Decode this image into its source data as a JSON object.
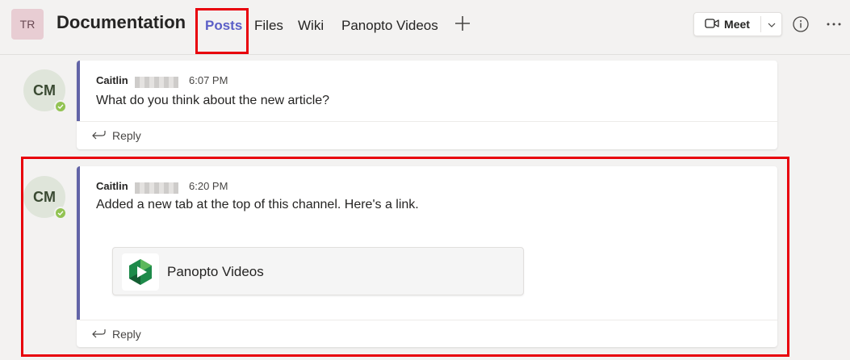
{
  "header": {
    "team_initials": "TR",
    "channel_title": "Documentation",
    "tabs": [
      {
        "label": "Posts",
        "active": true
      },
      {
        "label": "Files",
        "active": false
      },
      {
        "label": "Wiki",
        "active": false
      },
      {
        "label": "Panopto Videos",
        "active": false
      }
    ],
    "meet_label": "Meet"
  },
  "posts": [
    {
      "avatar_initials": "CM",
      "author": "Caitlin",
      "time": "6:07 PM",
      "message": "What do you think about the new article?",
      "reply_label": "Reply"
    },
    {
      "avatar_initials": "CM",
      "author": "Caitlin",
      "time": "6:20 PM",
      "message": "Added a new tab at the top of this channel. Here's a link.",
      "card_title": "Panopto Videos",
      "reply_label": "Reply"
    }
  ],
  "colors": {
    "accent": "#5b5fc7",
    "post_border": "#6264a7",
    "highlight": "#e8000b",
    "presence": "#92c353",
    "panopto_green": "#1e8a4a"
  }
}
